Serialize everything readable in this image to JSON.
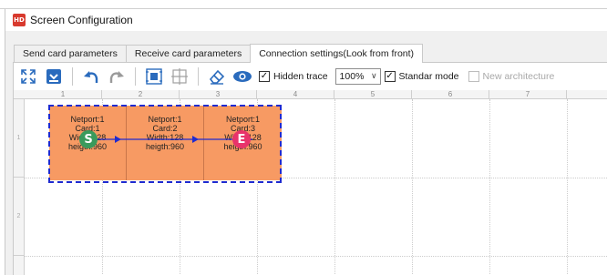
{
  "window": {
    "title": "Screen Configuration",
    "app_icon_text": "HD"
  },
  "tabs": [
    {
      "label": "Send card parameters"
    },
    {
      "label": "Receive card parameters"
    },
    {
      "label": "Connection settings(Look from front)"
    }
  ],
  "toolbar": {
    "icons": [
      "expand-icon",
      "save-icon",
      "undo-icon",
      "redo-icon",
      "select-screen-icon",
      "split-icon",
      "eraser-icon",
      "eye-icon"
    ],
    "hidden_trace": {
      "label": "Hidden trace",
      "checked": "✓"
    },
    "zoom": {
      "value": "100%",
      "arrow": "∨"
    },
    "standard_mode": {
      "label": "Standar mode",
      "checked": "✓"
    },
    "new_architecture": {
      "label": "New architecture",
      "checked": ""
    }
  },
  "ruler": {
    "columns": [
      "1",
      "2",
      "3",
      "4",
      "5",
      "6",
      "7"
    ],
    "rows": [
      "1",
      "2"
    ]
  },
  "cards": [
    {
      "netport": "Netport:1",
      "card": "Card:1",
      "width": "Width:128",
      "height": "heigth:960"
    },
    {
      "netport": "Netport:1",
      "card": "Card:2",
      "width": "Width:128",
      "height": "heigth:960"
    },
    {
      "netport": "Netport:1",
      "card": "Card:3",
      "width": "Width:128",
      "height": "heigth:960"
    }
  ],
  "markers": {
    "start": "S",
    "end": "E"
  },
  "colors": {
    "card_fill": "#f79a63",
    "screen_border": "#1f2bd0",
    "trace_line": "#1f2bd0",
    "start_marker": "#3a9a5c",
    "end_marker": "#e8336b"
  }
}
